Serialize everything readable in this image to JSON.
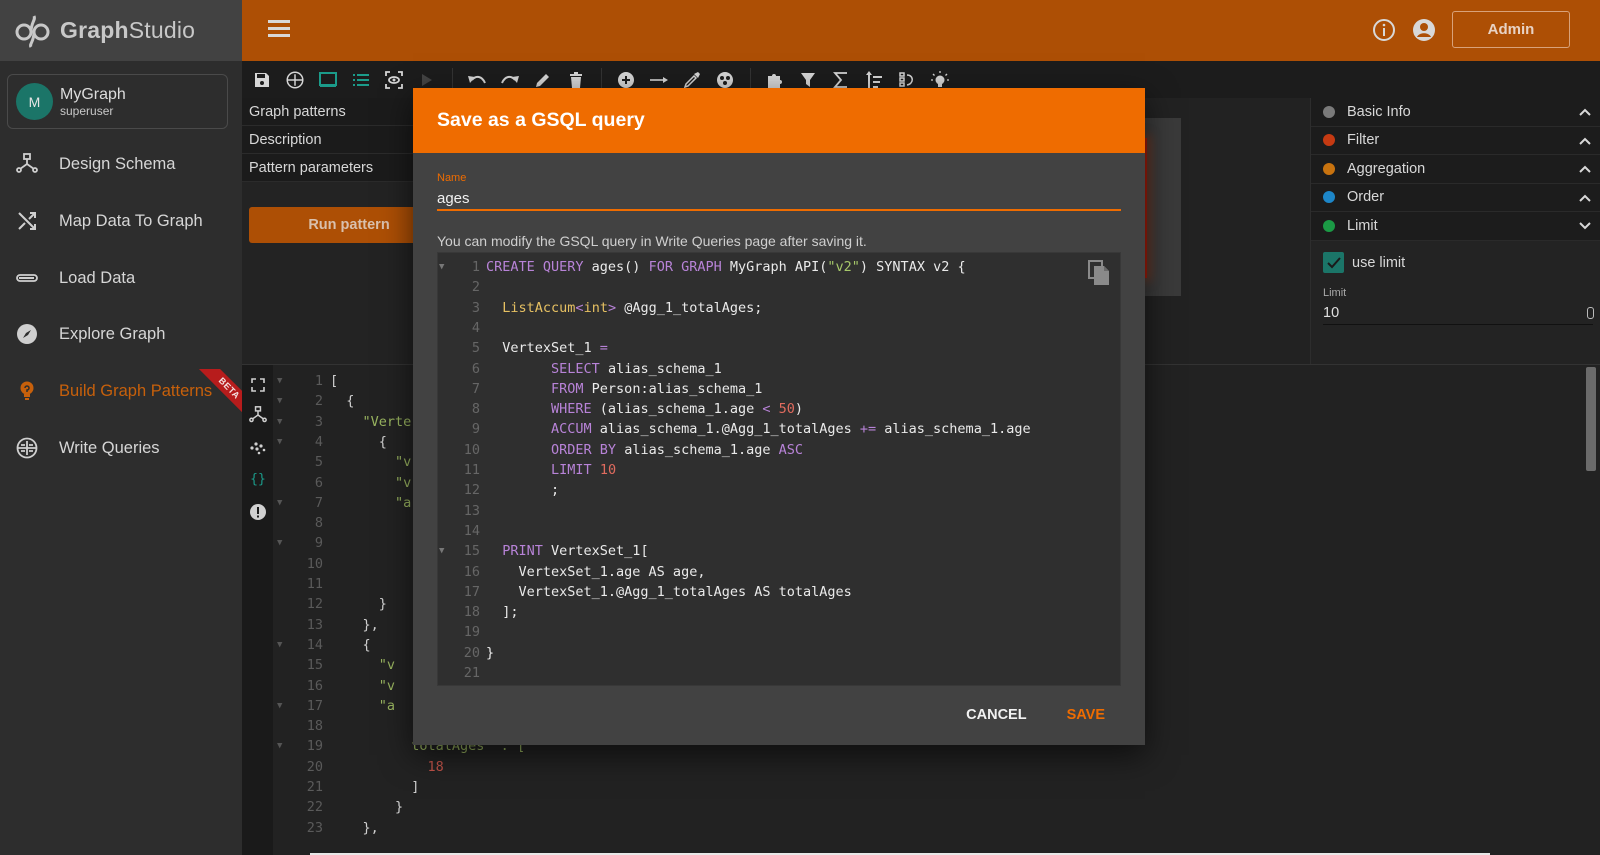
{
  "app": {
    "logo_bold": "Graph",
    "logo_light": "Studio",
    "admin_label": "Admin"
  },
  "graph": {
    "avatar_letter": "M",
    "name": "MyGraph",
    "role": "superuser"
  },
  "sidebar": {
    "items": [
      {
        "label": "Design Schema",
        "icon": "design-schema-icon"
      },
      {
        "label": "Map Data To Graph",
        "icon": "shuffle-icon"
      },
      {
        "label": "Load Data",
        "icon": "load-data-icon"
      },
      {
        "label": "Explore Graph",
        "icon": "compass-icon"
      },
      {
        "label": "Build Graph Patterns",
        "icon": "lightbulb-icon",
        "active": true,
        "badge": "BETA"
      },
      {
        "label": "Write Queries",
        "icon": "gsql-icon"
      }
    ]
  },
  "toolbar": {
    "groups": [
      [
        "save-icon",
        "gsql-icon",
        "monitor-icon",
        "list-icon",
        "eye-scan-icon",
        "play-icon"
      ],
      [
        "undo-icon",
        "redo-icon",
        "pencil-icon",
        "trash-icon"
      ],
      [
        "add-vertex-icon",
        "add-edge-icon",
        "eyedropper-icon",
        "palette-icon"
      ],
      [
        "puzzle-icon",
        "filter-icon",
        "sigma-icon",
        "sort-icon",
        "order-icon",
        "lightbulb-icon"
      ]
    ]
  },
  "pattern_panel": {
    "rows": [
      "Graph patterns",
      "Description",
      "Pattern parameters"
    ],
    "run_label": "Run pattern"
  },
  "right_panel": {
    "sections": [
      {
        "label": "Basic Info",
        "color": "#7a7a7a",
        "expanded": false
      },
      {
        "label": "Filter",
        "color": "#c53a12",
        "expanded": false
      },
      {
        "label": "Aggregation",
        "color": "#c8730f",
        "expanded": false
      },
      {
        "label": "Order",
        "color": "#1d86c8",
        "expanded": false
      },
      {
        "label": "Limit",
        "color": "#1b9a45",
        "expanded": true
      }
    ],
    "use_limit_label": "use limit",
    "use_limit_checked": true,
    "limit_label": "Limit",
    "limit_value": "10"
  },
  "json_result": {
    "lines": [
      {
        "n": "1",
        "fold": true,
        "text": "["
      },
      {
        "n": "2",
        "fold": true,
        "text": "  {"
      },
      {
        "n": "3",
        "fold": true,
        "text": "    ",
        "str": "\"Verte"
      },
      {
        "n": "4",
        "fold": true,
        "text": "      {"
      },
      {
        "n": "5",
        "fold": false,
        "text": "        ",
        "str": "\"v"
      },
      {
        "n": "6",
        "fold": false,
        "text": "        ",
        "str": "\"v"
      },
      {
        "n": "7",
        "fold": true,
        "text": "        ",
        "str": "\"a"
      },
      {
        "n": "8",
        "fold": false,
        "text": ""
      },
      {
        "n": "9",
        "fold": true,
        "text": ""
      },
      {
        "n": "10",
        "fold": false,
        "text": ""
      },
      {
        "n": "11",
        "fold": false,
        "text": ""
      },
      {
        "n": "12",
        "fold": false,
        "text": "      }"
      },
      {
        "n": "13",
        "fold": false,
        "text": "    },"
      },
      {
        "n": "14",
        "fold": true,
        "text": "    {"
      },
      {
        "n": "15",
        "fold": false,
        "text": "      ",
        "str": "\"v"
      },
      {
        "n": "16",
        "fold": false,
        "text": "      ",
        "str": "\"v"
      },
      {
        "n": "17",
        "fold": true,
        "text": "      ",
        "str": "\"a"
      },
      {
        "n": "18",
        "fold": false,
        "text": ""
      },
      {
        "n": "19",
        "fold": true,
        "text": "          ",
        "str": "totalAges\" : ["
      },
      {
        "n": "20",
        "fold": false,
        "text": "            ",
        "num": "18"
      },
      {
        "n": "21",
        "fold": false,
        "text": "          ]"
      },
      {
        "n": "22",
        "fold": false,
        "text": "        }"
      },
      {
        "n": "23",
        "fold": false,
        "text": "    },"
      }
    ]
  },
  "modal": {
    "title": "Save as a GSQL query",
    "name_label": "Name",
    "name_value": "ages",
    "hint": "You can modify the GSQL query in Write Queries page after saving it.",
    "cancel_label": "CANCEL",
    "save_label": "SAVE",
    "code_lines": [
      {
        "n": "1",
        "fold": true,
        "tokens": [
          [
            "kw",
            "CREATE QUERY"
          ],
          [
            "",
            "ages() "
          ],
          [
            "kw",
            "FOR GRAPH"
          ],
          [
            "",
            "MyGraph API("
          ],
          [
            "st",
            "\"v2\""
          ],
          [
            "",
            ") SYNTAX v2 {"
          ]
        ]
      },
      {
        "n": "2",
        "fold": false,
        "tokens": []
      },
      {
        "n": "3",
        "fold": false,
        "tokens": [
          [
            "",
            "  "
          ],
          [
            "ty",
            "ListAccum"
          ],
          [
            "op",
            "<"
          ],
          [
            "ty",
            "int"
          ],
          [
            "op",
            ">"
          ],
          [
            "",
            " @Agg_1_totalAges;"
          ]
        ]
      },
      {
        "n": "4",
        "fold": false,
        "tokens": []
      },
      {
        "n": "5",
        "fold": false,
        "tokens": [
          [
            "",
            "  VertexSet_1 "
          ],
          [
            "op",
            "="
          ]
        ]
      },
      {
        "n": "6",
        "fold": false,
        "tokens": [
          [
            "",
            "        "
          ],
          [
            "kw",
            "SELECT"
          ],
          [
            "",
            " alias_schema_1"
          ]
        ]
      },
      {
        "n": "7",
        "fold": false,
        "tokens": [
          [
            "",
            "        "
          ],
          [
            "kw",
            "FROM"
          ],
          [
            "",
            " Person:alias_schema_1"
          ]
        ]
      },
      {
        "n": "8",
        "fold": false,
        "tokens": [
          [
            "",
            "        "
          ],
          [
            "kw",
            "WHERE"
          ],
          [
            "",
            " (alias_schema_1.age "
          ],
          [
            "op",
            "<"
          ],
          [
            "",
            " "
          ],
          [
            "nm",
            "50"
          ],
          [
            "",
            ")"
          ]
        ]
      },
      {
        "n": "9",
        "fold": false,
        "tokens": [
          [
            "",
            "        "
          ],
          [
            "kw",
            "ACCUM"
          ],
          [
            "",
            " alias_schema_1.@Agg_1_totalAges "
          ],
          [
            "op",
            "+="
          ],
          [
            "",
            " alias_schema_1.age"
          ]
        ]
      },
      {
        "n": "10",
        "fold": false,
        "tokens": [
          [
            "",
            "        "
          ],
          [
            "kw",
            "ORDER BY"
          ],
          [
            "",
            " alias_schema_1.age "
          ],
          [
            "kw",
            "ASC"
          ]
        ]
      },
      {
        "n": "11",
        "fold": false,
        "tokens": [
          [
            "",
            "        "
          ],
          [
            "kw",
            "LIMIT"
          ],
          [
            "",
            " "
          ],
          [
            "nm",
            "10"
          ]
        ]
      },
      {
        "n": "12",
        "fold": false,
        "tokens": [
          [
            "",
            "        ;"
          ]
        ]
      },
      {
        "n": "13",
        "fold": false,
        "tokens": []
      },
      {
        "n": "14",
        "fold": false,
        "tokens": []
      },
      {
        "n": "15",
        "fold": true,
        "tokens": [
          [
            "",
            "  "
          ],
          [
            "kw",
            "PRINT"
          ],
          [
            "",
            " VertexSet_1["
          ]
        ]
      },
      {
        "n": "16",
        "fold": false,
        "tokens": [
          [
            "",
            "    VertexSet_1.age AS age,"
          ]
        ]
      },
      {
        "n": "17",
        "fold": false,
        "tokens": [
          [
            "",
            "    VertexSet_1.@Agg_1_totalAges AS totalAges"
          ]
        ]
      },
      {
        "n": "18",
        "fold": false,
        "tokens": [
          [
            "",
            "  ];"
          ]
        ]
      },
      {
        "n": "19",
        "fold": false,
        "tokens": []
      },
      {
        "n": "20",
        "fold": false,
        "tokens": [
          [
            "",
            "}"
          ]
        ]
      },
      {
        "n": "21",
        "fold": false,
        "tokens": []
      }
    ]
  }
}
